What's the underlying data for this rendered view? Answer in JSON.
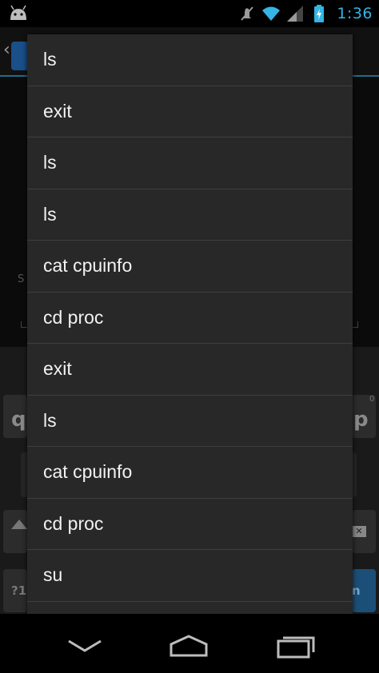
{
  "status_bar": {
    "time": "1:36",
    "icons": [
      "android-icon",
      "mute-icon",
      "wifi-icon",
      "signal-icon",
      "battery-charging-icon"
    ],
    "accent_color": "#33b5e5"
  },
  "background": {
    "label_partial": "S",
    "keyboard": {
      "key_q": "q",
      "key_p": "p",
      "key_p_alt": "0",
      "key_sym": "?1",
      "key_go": "n"
    }
  },
  "history_popup": {
    "items": [
      "ls",
      "exit",
      "ls",
      "ls",
      "cat cpuinfo",
      "cd proc",
      "exit",
      "ls",
      "cat cpuinfo",
      "cd proc",
      "su",
      ""
    ]
  },
  "nav_bar": {
    "icons": [
      "back-icon",
      "home-icon",
      "recent-apps-icon"
    ]
  }
}
